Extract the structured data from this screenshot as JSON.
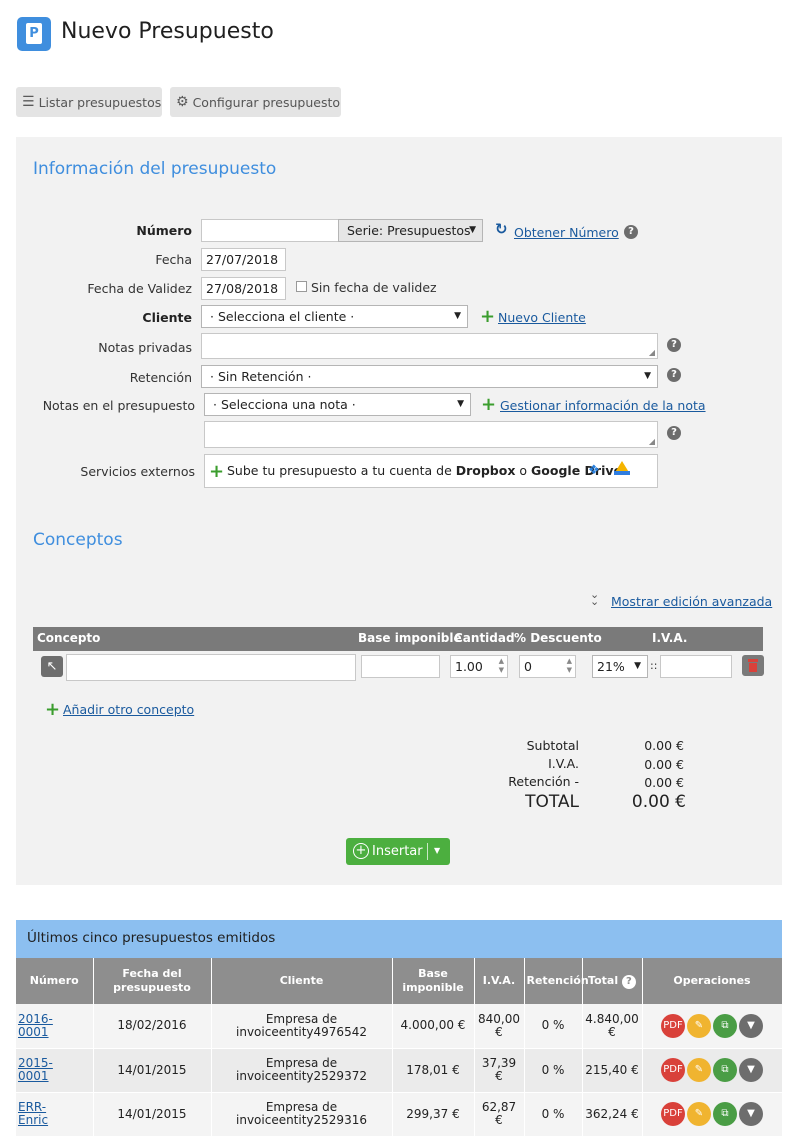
{
  "header": {
    "app_icon_letter": "P",
    "title": "Nuevo Presupuesto"
  },
  "toolbar": {
    "list_label": "Listar presupuestos",
    "config_label": "Configurar presupuesto"
  },
  "info": {
    "section_title": "Información del presupuesto",
    "numero_label": "Número",
    "numero_value": "",
    "serie_label": "Serie: Presupuestos",
    "obtener_label": "Obtener Número",
    "fecha_label": "Fecha",
    "fecha_value": "27/07/2018",
    "validez_label": "Fecha de Validez",
    "validez_value": "27/08/2018",
    "sin_validez_label": "Sin fecha de validez",
    "cliente_label": "Cliente",
    "cliente_placeholder": "· Selecciona el cliente ·",
    "nuevo_cliente_label": "Nuevo Cliente",
    "notas_privadas_label": "Notas privadas",
    "retencion_label": "Retención",
    "retencion_value": "· Sin Retención ·",
    "notas_presupuesto_label": "Notas en el presupuesto",
    "nota_placeholder": "· Selecciona una nota ·",
    "gestionar_label": "Gestionar información de la nota",
    "servicios_label": "Servicios externos",
    "servicios_text_a": "Sube tu presupuesto a tu cuenta de ",
    "servicios_dropbox": "Dropbox",
    "servicios_o": " o ",
    "servicios_gdrive": "Google Drive"
  },
  "conceptos": {
    "section_title": "Conceptos",
    "advanced_label": "Mostrar edición avanzada",
    "columns": {
      "concepto": "Concepto",
      "base": "Base imponible",
      "cantidad": "Cantidad",
      "descuento": "% Descuento",
      "iva": "I.V.A."
    },
    "row": {
      "concepto": "",
      "base": "",
      "cantidad": "1.00",
      "descuento": "0",
      "iva_rate": "21%",
      "iva_sep": "::",
      "iva_total": ""
    },
    "add_label": "Añadir otro concepto"
  },
  "totals": {
    "subtotal_label": "Subtotal",
    "subtotal_value": "0.00 €",
    "iva_label": "I.V.A.",
    "iva_value": "0.00 €",
    "retencion_label": "Retención -",
    "retencion_value": "0.00 €",
    "total_label": "TOTAL",
    "total_value": "0.00 €"
  },
  "insert_button": {
    "label": "Insertar"
  },
  "recent": {
    "title": "Últimos cinco presupuestos emitidos",
    "columns": {
      "numero": "Número",
      "fecha_a": "Fecha del",
      "fecha_b": "presupuesto",
      "cliente": "Cliente",
      "base_a": "Base",
      "base_b": "imponible",
      "iva": "I.V.A.",
      "retencion": "Retención",
      "total": "Total",
      "operaciones": "Operaciones"
    },
    "rows": [
      {
        "numero_a": "2016-",
        "numero_b": "0001",
        "fecha": "18/02/2016",
        "cliente_a": "Empresa de",
        "cliente_b": "invoiceentity4976542",
        "base": "4.000,00 €",
        "iva_a": "840,00",
        "iva_b": "€",
        "retencion": "0 %",
        "total_a": "4.840,00",
        "total_b": "€"
      },
      {
        "numero_a": "2015-",
        "numero_b": "0001",
        "fecha": "14/01/2015",
        "cliente_a": "Empresa de",
        "cliente_b": "invoiceentity2529372",
        "base": "178,01 €",
        "iva_a": "37,39 €",
        "iva_b": "",
        "retencion": "0 %",
        "total_a": "215,40 €",
        "total_b": ""
      },
      {
        "numero_a": "ERR-",
        "numero_b": "Enric",
        "fecha": "14/01/2015",
        "cliente_a": "Empresa de",
        "cliente_b": "invoiceentity2529316",
        "base": "299,37 €",
        "iva_a": "62,87 €",
        "iva_b": "",
        "retencion": "0 %",
        "total_a": "362,24 €",
        "total_b": ""
      }
    ]
  },
  "colors": {
    "accent": "#3f8ede",
    "panel_bg": "#f2f2f2",
    "link": "#1a5a9e",
    "success": "#4caf3f",
    "recent_header": "#8cbff0"
  },
  "icons": {
    "list": "list-icon",
    "gear": "gear-icon",
    "refresh": "refresh-icon",
    "help": "help-icon",
    "plus": "plus-icon",
    "dropbox": "dropbox-icon",
    "gdrive": "google-drive-icon",
    "cursor": "cursor-icon",
    "trash": "trash-icon",
    "chevrons": "double-chevron-down-icon",
    "pdf": "pdf-icon",
    "edit": "pencil-icon",
    "copy": "copy-icon",
    "more": "chevron-down-icon"
  }
}
